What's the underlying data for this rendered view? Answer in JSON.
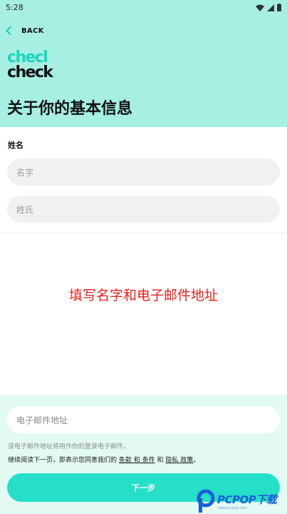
{
  "status_bar": {
    "time": "5:28"
  },
  "nav": {
    "back_label": "BACK"
  },
  "logo": {
    "line1": "checl",
    "line2": "check"
  },
  "page": {
    "title": "关于你的基本信息"
  },
  "name_section": {
    "label": "姓名",
    "first_name_placeholder": "名字",
    "last_name_placeholder": "姓氏"
  },
  "overlay": {
    "text": "填写名字和电子邮件地址"
  },
  "email": {
    "placeholder": "电子邮件地址",
    "note": "该电子邮件地址将用作你的登录电子邮件。",
    "terms_prefix": "继续阅读下一页，即表示您同意我们的",
    "terms_link": "条款 和 条件",
    "terms_and": "和",
    "privacy_link": "隐私 政策",
    "terms_suffix": "。"
  },
  "next_button": {
    "label": "下一步"
  },
  "watermark": {
    "brand": "PCPOP下载",
    "sub": "www.pcpop.com"
  },
  "colors": {
    "header_bg": "#a6efe2",
    "accent": "#25dfc8",
    "bottom_panel_bg": "#e2f9f4",
    "overlay_text": "#e4231d"
  }
}
